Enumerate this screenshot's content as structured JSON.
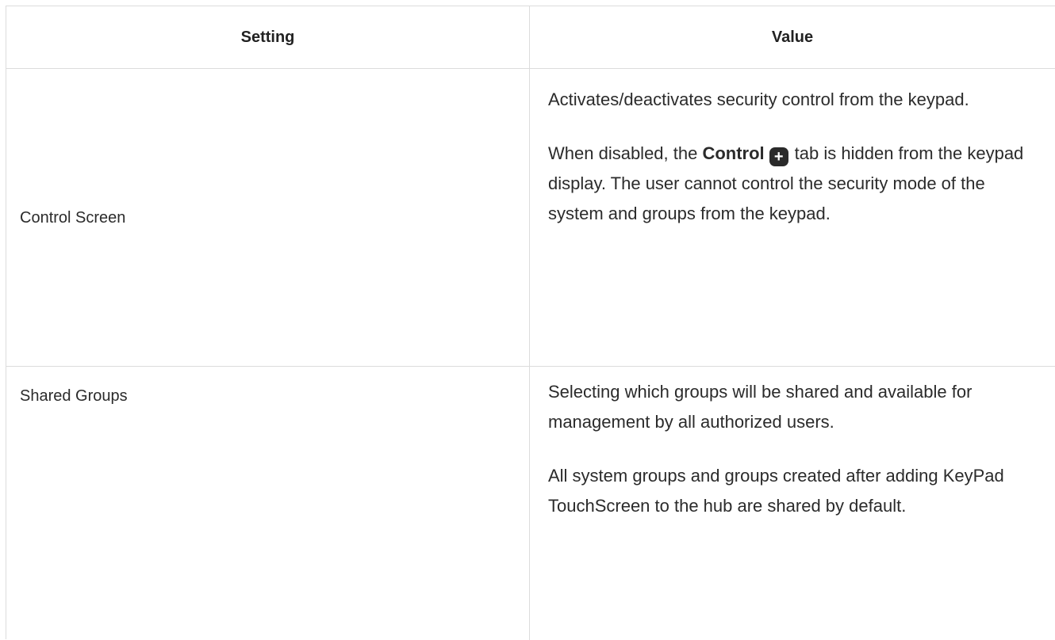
{
  "table": {
    "headers": {
      "setting": "Setting",
      "value": "Value"
    },
    "rows": [
      {
        "setting": "Control Screen",
        "value_p1": "Activates/deactivates security control from the keypad.",
        "value_p2_before": "When disabled, the",
        "value_p2_bold": "Control",
        "value_p2_icon": "plus-icon",
        "value_p2_after": "tab is hidden from the keypad display. The user cannot control the security mode of the system and groups from the keypad."
      },
      {
        "setting": "Shared Groups",
        "value_p1": "Selecting which groups will be shared and available for management by all authorized users.",
        "value_p2": "All system groups and groups created after adding KeyPad TouchScreen to the hub are shared by default."
      }
    ]
  }
}
